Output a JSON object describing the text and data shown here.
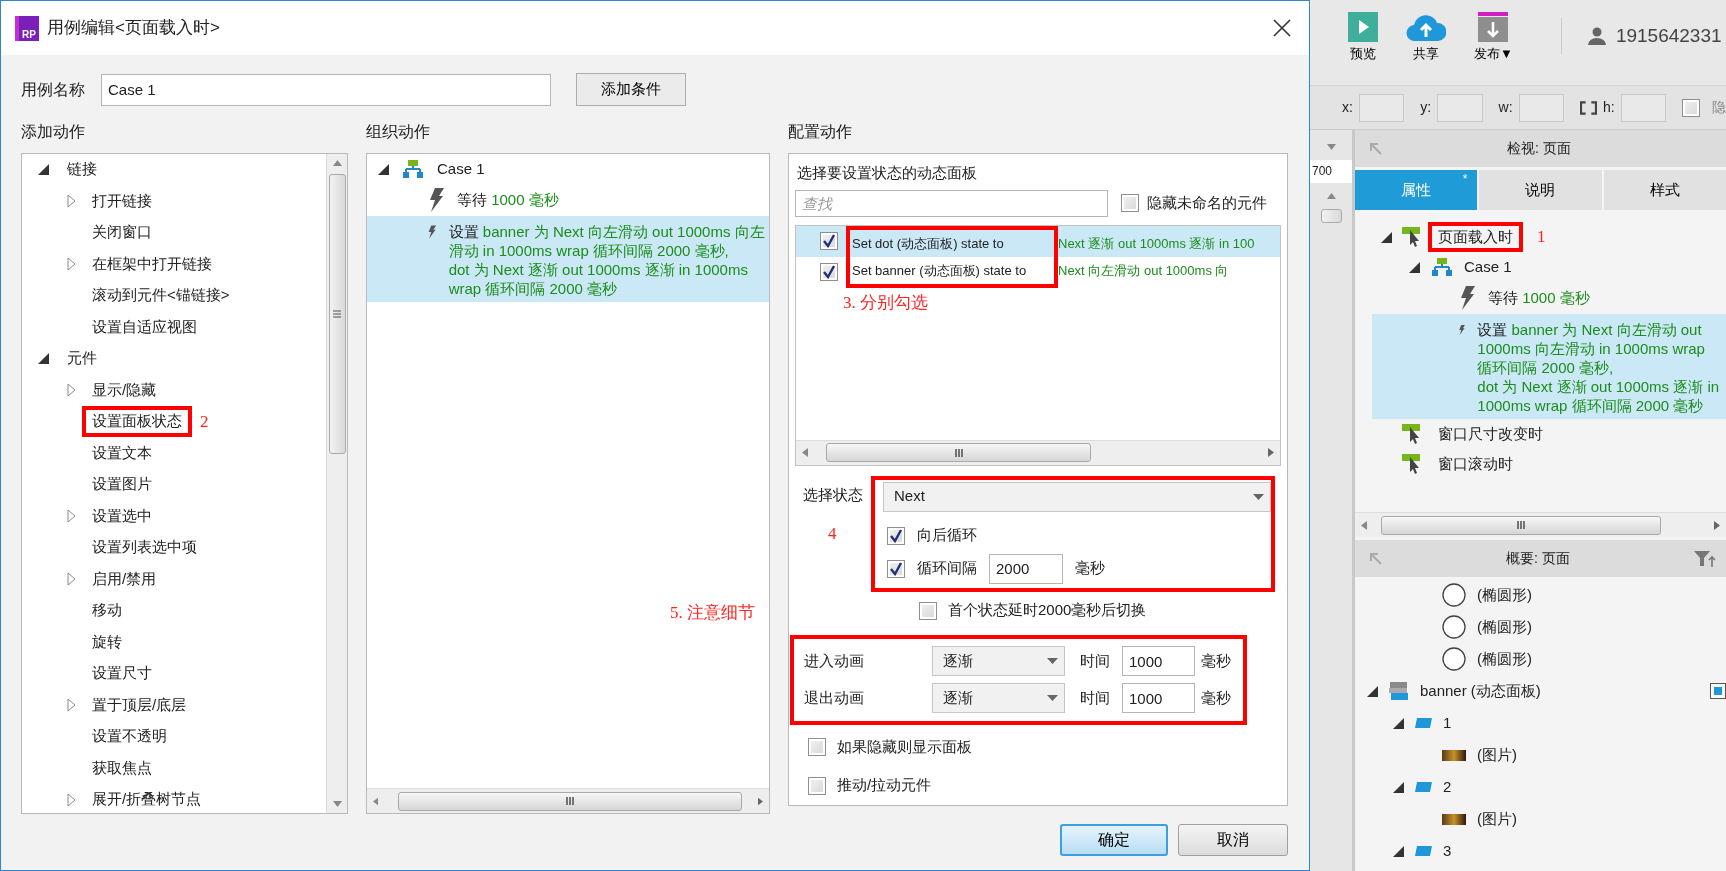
{
  "dialog": {
    "logo": "RP",
    "title": "用例编辑<页面载入时>",
    "case_name_label": "用例名称",
    "case_name": "Case 1",
    "add_condition_button": "添加条件",
    "add_actions": {
      "heading": "添加动作",
      "tree": [
        {
          "label": "链接",
          "expanded": true,
          "children": [
            {
              "label": "打开链接",
              "has_children": true
            },
            {
              "label": "关闭窗口",
              "has_children": false
            },
            {
              "label": "在框架中打开链接",
              "has_children": true
            },
            {
              "label": "滚动到元件<锚链接>",
              "has_children": false
            },
            {
              "label": "设置自适应视图",
              "has_children": false
            }
          ]
        },
        {
          "label": "元件",
          "expanded": true,
          "children": [
            {
              "label": "显示/隐藏",
              "has_children": true
            },
            {
              "label": "设置面板状态",
              "has_children": false,
              "highlight": true,
              "note": "2"
            },
            {
              "label": "设置文本",
              "has_children": false
            },
            {
              "label": "设置图片",
              "has_children": false
            },
            {
              "label": "设置选中",
              "has_children": true
            },
            {
              "label": "设置列表选中项",
              "has_children": false
            },
            {
              "label": "启用/禁用",
              "has_children": true
            },
            {
              "label": "移动",
              "has_children": false
            },
            {
              "label": "旋转",
              "has_children": false
            },
            {
              "label": "设置尺寸",
              "has_children": false
            },
            {
              "label": "置于顶层/底层",
              "has_children": true
            },
            {
              "label": "设置不透明",
              "has_children": false
            },
            {
              "label": "获取焦点",
              "has_children": false
            },
            {
              "label": "展开/折叠树节点",
              "has_children": true
            }
          ]
        }
      ]
    },
    "organize_actions": {
      "heading": "组织动作",
      "note": "5. 注意细节",
      "tree": [
        {
          "label": "Case 1",
          "expanded": true,
          "children": [
            {
              "verb": "等待",
              "detail": "1000 毫秒",
              "selected": false
            },
            {
              "verb": "设置",
              "detail": "banner 为 Next 向左滑动 out 1000ms 向左滑动 in 1000ms wrap 循环间隔 2000 毫秒,\ndot 为 Next 逐渐 out 1000ms 逐渐 in 1000ms wrap 循环间隔 2000 毫秒",
              "selected": true
            }
          ]
        }
      ]
    },
    "configure": {
      "heading": "配置动作",
      "panel_picker": {
        "heading": "选择要设置状态的动态面板",
        "search_placeholder": "查找",
        "hide_unnamed": {
          "label": "隐藏未命名的元件",
          "checked": false
        },
        "highlight": true,
        "note": "3. 分别勾选",
        "panels": [
          {
            "prefix": "Set dot (动态面板) state to ",
            "detail": "Next 逐渐 out 1000ms 逐渐 in 100",
            "checked": true,
            "selected": true
          },
          {
            "prefix": "Set banner (动态面板) state to ",
            "detail": "Next 向左滑动 out 1000ms 向",
            "checked": true,
            "selected": false
          }
        ]
      },
      "state": {
        "label": "选择状态",
        "value": "Next",
        "highlight": true,
        "note": "4",
        "wrap": {
          "label": "向后循环",
          "checked": true
        },
        "repeat": {
          "label": "循环间隔",
          "checked": true,
          "value": "2000",
          "unit": "毫秒"
        },
        "first_delay": {
          "label": "首个状态延时2000毫秒后切换",
          "checked": false
        }
      },
      "animations": {
        "highlight": true,
        "rows": [
          {
            "label": "进入动画",
            "value": "逐渐",
            "time_label": "时间",
            "time": "1000",
            "unit": "毫秒"
          },
          {
            "label": "退出动画",
            "value": "逐渐",
            "time_label": "时间",
            "time": "1000",
            "unit": "毫秒"
          }
        ]
      },
      "options": [
        {
          "label": "如果隐藏则显示面板",
          "checked": false
        },
        {
          "label": "推动/拉动元件",
          "checked": false
        }
      ]
    },
    "buttons": [
      {
        "label": "确定",
        "primary": true
      },
      {
        "label": "取消",
        "primary": false
      }
    ]
  },
  "app": {
    "toolbar": [
      {
        "label": "预览",
        "kind": "preview"
      },
      {
        "label": "共享",
        "kind": "share"
      },
      {
        "label": "发布▼",
        "kind": "publish"
      }
    ],
    "user": "1915642331",
    "geometry": [
      {
        "label": "x:"
      },
      {
        "label": "y:"
      },
      {
        "label": "w:"
      },
      {
        "label": "h:"
      }
    ],
    "hidden_checkbox": {
      "label": "隐",
      "checked": false
    },
    "ruler": "700",
    "inspector": {
      "title": "检视: 页面",
      "tabs": [
        {
          "label": "属性",
          "selected": true,
          "marker": "*"
        },
        {
          "label": "说明",
          "selected": false
        },
        {
          "label": "样式",
          "selected": false
        }
      ],
      "events": [
        {
          "label": "页面载入时",
          "expanded": true,
          "highlight": true,
          "note": "1",
          "children": [
            {
              "label": "Case 1",
              "expanded": true,
              "actions": [
                {
                  "verb": "等待",
                  "detail": "1000 毫秒",
                  "selected": false
                },
                {
                  "verb": "设置",
                  "detail": "banner 为 Next 向左滑动 out 1000ms 向左滑动 in 1000ms wrap 循环间隔 2000 毫秒,\ndot 为 Next 逐渐 out 1000ms 逐渐 in 1000ms wrap 循环间隔 2000 毫秒",
                  "selected": true
                }
              ]
            }
          ]
        },
        {
          "label": "窗口尺寸改变时"
        },
        {
          "label": "窗口滚动时"
        }
      ]
    },
    "outline": {
      "title": "概要: 页面",
      "items": [
        {
          "label": "(椭圆形)",
          "kind": "ellipse"
        },
        {
          "label": "(椭圆形)",
          "kind": "ellipse"
        },
        {
          "label": "(椭圆形)",
          "kind": "ellipse"
        },
        {
          "label": "banner (动态面板)",
          "kind": "panel",
          "expanded": true,
          "children": [
            {
              "label": "1",
              "kind": "state",
              "expanded": true,
              "children": [
                {
                  "label": "(图片)",
                  "kind": "image"
                }
              ]
            },
            {
              "label": "2",
              "kind": "state",
              "expanded": true,
              "children": [
                {
                  "label": "(图片)",
                  "kind": "image"
                }
              ]
            },
            {
              "label": "3",
              "kind": "state",
              "expanded": true
            }
          ]
        }
      ]
    }
  }
}
